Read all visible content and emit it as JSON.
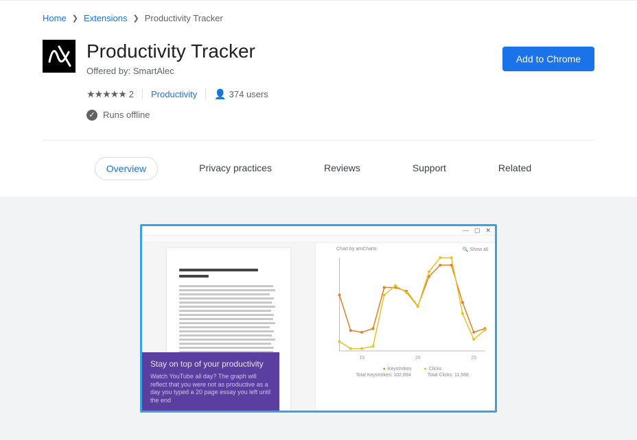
{
  "breadcrumbs": {
    "home": "Home",
    "extensions": "Extensions",
    "current": "Productivity Tracker"
  },
  "header": {
    "title": "Productivity Tracker",
    "offered_by_prefix": "Offered by: ",
    "offered_by": "SmartAlec",
    "rating_count": "2",
    "category": "Productivity",
    "users": "374 users",
    "runs_offline": "Runs offline",
    "add_button": "Add to Chrome"
  },
  "tabs": {
    "overview": "Overview",
    "privacy": "Privacy practices",
    "reviews": "Reviews",
    "support": "Support",
    "related": "Related"
  },
  "screenshot": {
    "callout_title": "Stay on top of your productivity",
    "callout_body": "Watch YouTube all day? The graph will reflect that you were not as productive as a day you typed a 20 page essay you left until the end",
    "chart_header": "Chart by amCharts",
    "show_all": "Show all",
    "legend_keystrokes": "Keystrokes",
    "legend_clicks": "Clicks",
    "total_keystrokes_label": "Total Keystrokes:",
    "total_keystrokes_val": "102,894",
    "total_clicks_label": "Total Clicks:",
    "total_clicks_val": "11,568"
  },
  "chart_data": {
    "type": "line",
    "title": "Chart by amCharts",
    "xlabel": "",
    "ylabel_left": "Keystrokes",
    "ylabel_right": "Clicks",
    "x_ticks": [
      15,
      20,
      25
    ],
    "ylim_left": [
      0,
      2500
    ],
    "ylim_right": [
      10000,
      30000
    ],
    "series": [
      {
        "name": "Keystrokes",
        "color": "#e67e22",
        "axis": "left",
        "x": [
          13,
          14,
          15,
          16,
          17,
          18,
          19,
          20,
          21,
          22,
          23,
          24,
          25,
          26
        ],
        "values": [
          1500,
          550,
          500,
          600,
          1700,
          1700,
          1600,
          1200,
          2000,
          2300,
          2300,
          1300,
          500,
          600
        ]
      },
      {
        "name": "Clicks",
        "color": "#e6c322",
        "axis": "right",
        "x": [
          13,
          14,
          15,
          16,
          17,
          18,
          19,
          20,
          21,
          22,
          23,
          24,
          25,
          26
        ],
        "values": [
          12000,
          10500,
          10500,
          11000,
          22000,
          24000,
          22500,
          19500,
          27000,
          30000,
          30000,
          18000,
          12500,
          14500
        ]
      }
    ]
  }
}
